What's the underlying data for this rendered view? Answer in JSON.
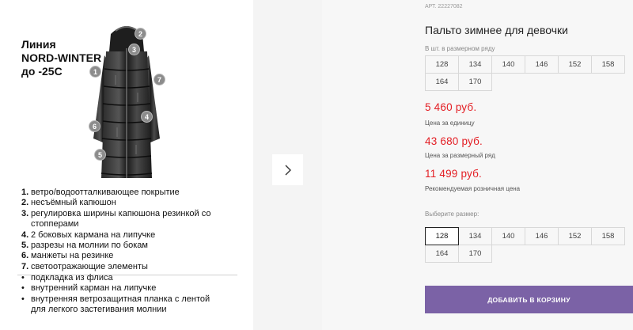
{
  "promo": {
    "line1": "Линия",
    "line2": "NORD-WINTER",
    "line3": "до -25С"
  },
  "coat_markers": [
    "1",
    "2",
    "3",
    "4",
    "5",
    "6",
    "7"
  ],
  "features": [
    {
      "num": "1.",
      "text": "ветро/водоотталкивающее покрытие"
    },
    {
      "num": "2.",
      "text": "несъёмный капюшон"
    },
    {
      "num": "3.",
      "text": "регулировка ширины капюшона  резинкой со стопперами"
    },
    {
      "num": "4.",
      "text": "2 боковых кармана на липучке"
    },
    {
      "num": "5.",
      "text": "разрезы на молнии по бокам"
    },
    {
      "num": "6.",
      "text": "манжеты на резинке"
    },
    {
      "num": "7.",
      "text": "светоотражающие элементы"
    }
  ],
  "extras": [
    "подкладка из флиса",
    "внутренний карман на липучке",
    "внутренняя ветрозащитная планка с лентой для легкого застегивания молнии"
  ],
  "product": {
    "sku": "АРТ. 22227082",
    "title": "Пальто зимнее для девочки",
    "pack_caption": "В шт. в размерном ряду",
    "pack_sizes": [
      "128",
      "134",
      "140",
      "146",
      "152",
      "158",
      "164",
      "170"
    ],
    "prices": [
      {
        "value": "5 460 руб.",
        "label": "Цена за единицу"
      },
      {
        "value": "43 680 руб.",
        "label": "Цена за размерный ряд"
      },
      {
        "value": "11 499 руб.",
        "label": "Рекомендуемая розничная цена"
      }
    ],
    "choose_caption": "Выберите размер:",
    "choose_sizes": [
      "128",
      "134",
      "140",
      "146",
      "152",
      "158",
      "164",
      "170"
    ],
    "selected_size": "128",
    "cart_button": "ДОБАВИТЬ В КОРЗИНУ"
  },
  "colors": {
    "accent": "#7b62a6",
    "price": "#e31e24"
  }
}
